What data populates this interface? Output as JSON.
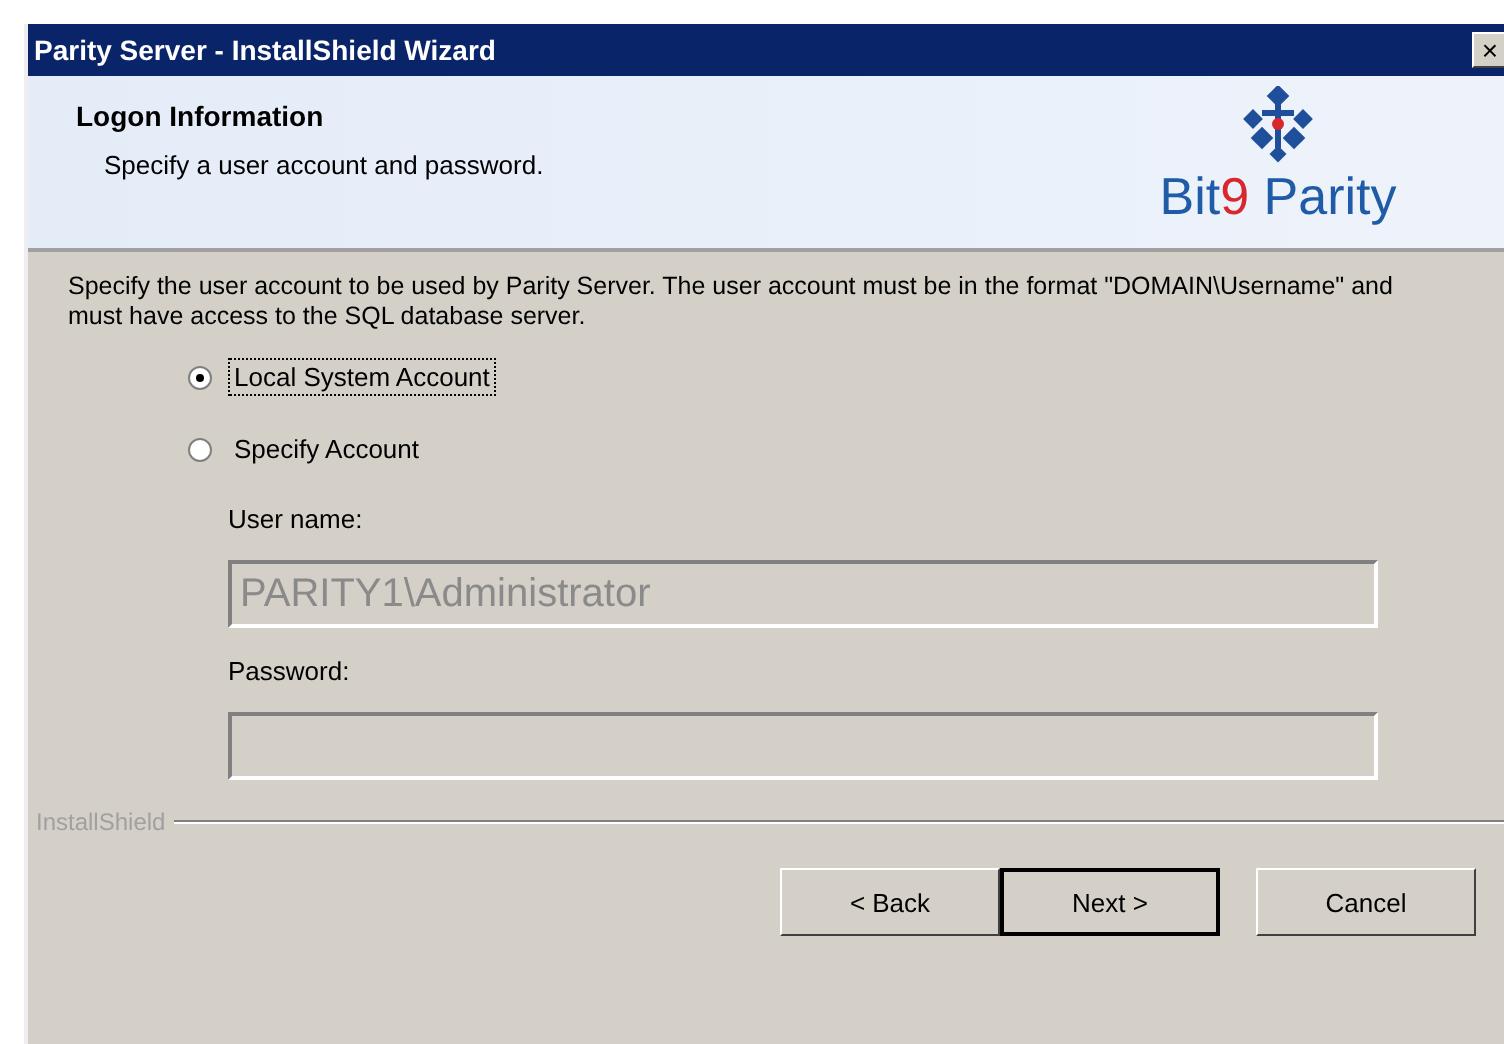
{
  "window": {
    "title": "Parity Server - InstallShield Wizard",
    "close": "×"
  },
  "header": {
    "title": "Logon Information",
    "subtitle": "Specify a user account and password.",
    "logo": {
      "brand": "Bit",
      "digit": "9",
      "product": " Parity"
    }
  },
  "description": "Specify the user account to be used by Parity Server.  The user account must be in the format \"DOMAIN\\Username\" and must have access to the SQL database server.",
  "options": [
    {
      "label": "Local System Account",
      "selected": true
    },
    {
      "label": "Specify Account",
      "selected": false
    }
  ],
  "fields": [
    {
      "label": "User name:",
      "value": "PARITY1\\Administrator",
      "disabled": true
    },
    {
      "label": "Password:",
      "disabled": true
    }
  ],
  "brand_label": "InstallShield",
  "buttons": [
    {
      "label": "< Back",
      "default": false
    },
    {
      "label": "Next >",
      "default": true
    },
    {
      "label": "Cancel",
      "default": false
    }
  ]
}
